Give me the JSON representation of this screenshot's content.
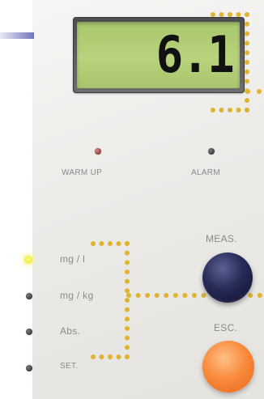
{
  "display": {
    "value": "6.1"
  },
  "indicators": {
    "warm_up_label": "WARM UP",
    "alarm_label": "ALARM"
  },
  "units": [
    {
      "label": "mg / l",
      "active": true
    },
    {
      "label": "mg / kg",
      "active": false
    },
    {
      "label": "Abs.",
      "active": false
    },
    {
      "label": "SET.",
      "active": false
    }
  ],
  "buttons": {
    "meas_label": "MEAS.",
    "esc_label": "ESC."
  },
  "colors": {
    "panel": "#ecebe8",
    "lcd_green": "#b2cf76",
    "callout_dots": "#e0b331",
    "meas_button": "#1b1f47",
    "esc_button": "#f98c3e",
    "active_led": "#f3ef4c",
    "accent_bar": "#6f75bd"
  }
}
